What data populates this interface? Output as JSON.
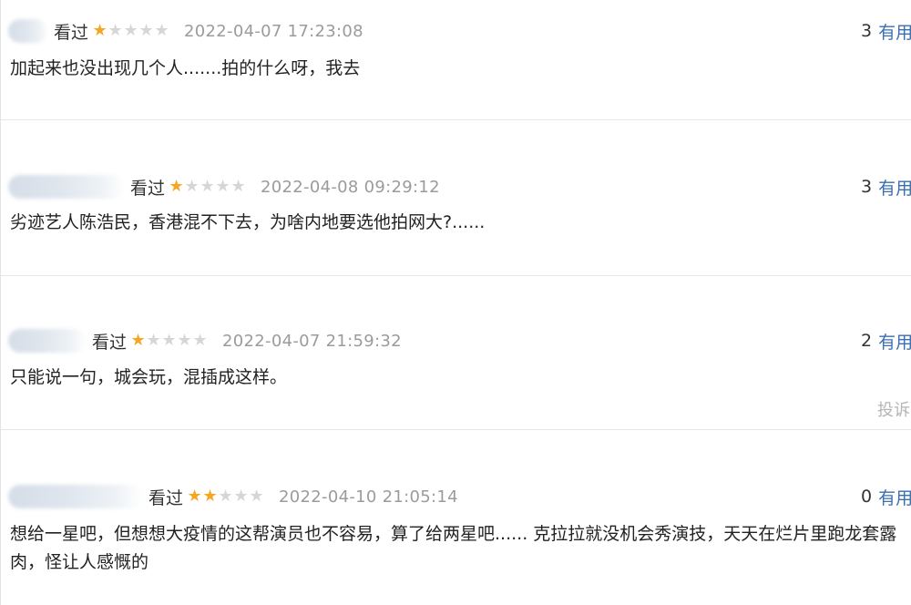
{
  "comments": [
    {
      "status": "看过",
      "rating": 1,
      "time": "2022-04-07 17:23:08",
      "useful_count": "3",
      "useful_label": "有用",
      "text": "加起来也没出现几个人.......拍的什么呀，我去"
    },
    {
      "status": "看过",
      "rating": 1,
      "time": "2022-04-08 09:29:12",
      "useful_count": "3",
      "useful_label": "有用",
      "text": "劣迹艺人陈浩民，香港混不下去，为啥内地要选他拍网大?......"
    },
    {
      "status": "看过",
      "rating": 1,
      "time": "2022-04-07 21:59:32",
      "useful_count": "2",
      "useful_label": "有用",
      "text": "只能说一句，城会玩，混插成这样。",
      "report_label": "投诉"
    },
    {
      "status": "看过",
      "rating": 2,
      "time": "2022-04-10 21:05:14",
      "useful_count": "0",
      "useful_label": "有用",
      "text": "想给一星吧，但想想大疫情的这帮演员也不容易，算了给两星吧...... 克拉拉就没机会秀演技，天天在烂片里跑龙套露肉，怪让人感慨的"
    }
  ],
  "colors": {
    "star_on": "#f5a623",
    "star_off": "#d6d6d6",
    "link": "#3a6fb0",
    "timestamp": "#9b9b9b"
  },
  "icons": {
    "star": "star-icon"
  }
}
